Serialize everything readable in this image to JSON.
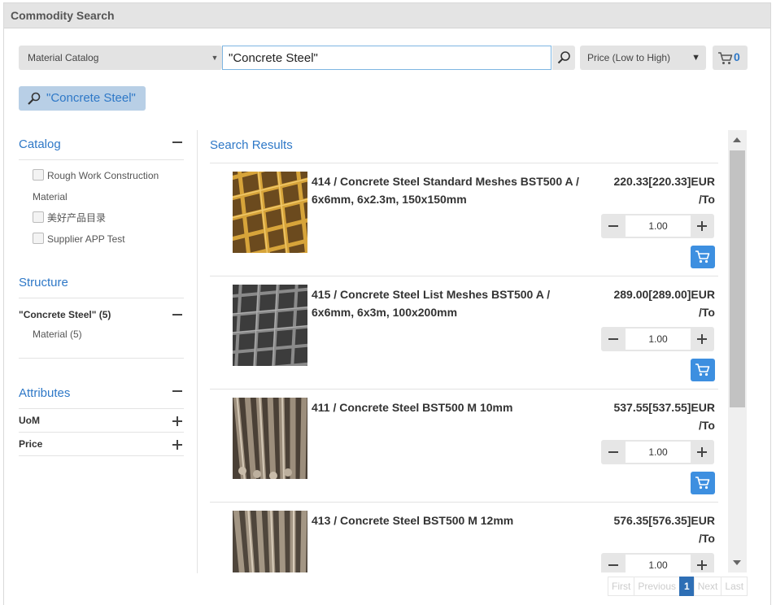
{
  "window": {
    "title": "Commodity Search"
  },
  "toolbar": {
    "catalog_select": "Material Catalog",
    "search_value": "\"Concrete Steel\"",
    "sort_select": "Price (Low to High)",
    "cart_count": "0"
  },
  "active_filter": {
    "label": "\"Concrete Steel\""
  },
  "sidebar": {
    "catalog": {
      "title": "Catalog",
      "items": [
        {
          "label_line1": "Rough Work Construction",
          "label_line2": "Material"
        },
        {
          "label_line1": "美好产品目录"
        },
        {
          "label_line1": "Supplier APP Test"
        }
      ]
    },
    "structure": {
      "title": "Structure",
      "node": "\"Concrete Steel\" (5)",
      "child": "Material (5)"
    },
    "attributes": {
      "title": "Attributes",
      "items": [
        {
          "label": "UoM"
        },
        {
          "label": "Price"
        }
      ]
    }
  },
  "results": {
    "title": "Search Results",
    "items": [
      {
        "name": "414 / Concrete Steel Standard Meshes BST500 A / 6x6mm, 6x2.3m, 150x150mm",
        "price": "220.33[220.33]EUR",
        "unit": "/To",
        "qty": "1.00",
        "image": "yellow-mesh"
      },
      {
        "name": "415 / Concrete Steel List Meshes BST500 A / 6x6mm, 6x3m, 100x200mm",
        "price": "289.00[289.00]EUR",
        "unit": "/To",
        "qty": "1.00",
        "image": "grey-mesh"
      },
      {
        "name": "411 / Concrete Steel BST500 M 10mm",
        "price": "537.55[537.55]EUR",
        "unit": "/To",
        "qty": "1.00",
        "image": "rebar-bundle"
      },
      {
        "name": "413 / Concrete Steel BST500 M 12mm",
        "price": "576.35[576.35]EUR",
        "unit": "/To",
        "qty": "1.00",
        "image": "rebar-bundle"
      }
    ]
  },
  "pagination": {
    "first": "First",
    "previous": "Previous",
    "current": "1",
    "next": "Next",
    "last": "Last"
  },
  "icons": {
    "search": "magnifier-icon",
    "cart": "cart-icon",
    "dropdown": "chevron-down-icon"
  },
  "colors": {
    "accent": "#2e78c7",
    "cart_button": "#3d8fe0",
    "active_page": "#2e6fb5",
    "chip": "#b8cfe6"
  }
}
